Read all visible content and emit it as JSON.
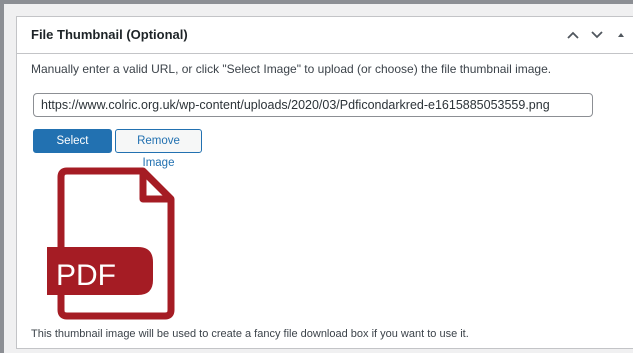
{
  "metabox": {
    "title": "File Thumbnail (Optional)",
    "description": "Manually enter a valid URL, or click \"Select Image\" to upload (or choose) the file thumbnail image.",
    "url_value": "https://www.colric.org.uk/wp-content/uploads/2020/03/Pdficondarkred-e1615885053559.png",
    "select_button": "Select Image",
    "remove_button": "Remove Image",
    "thumbnail": {
      "label": "PDF",
      "icon": "pdf-file-icon",
      "color": "#a51c24"
    },
    "footnote": "This thumbnail image will be used to create a fancy file download box if you want to use it.",
    "actions": {
      "move_up_icon": "chevron-up-icon",
      "move_down_icon": "chevron-down-icon",
      "toggle_icon": "triangle-up-icon"
    }
  },
  "colors": {
    "primary": "#2271b1",
    "border": "#c3c4c7",
    "text": "#1d2327"
  }
}
